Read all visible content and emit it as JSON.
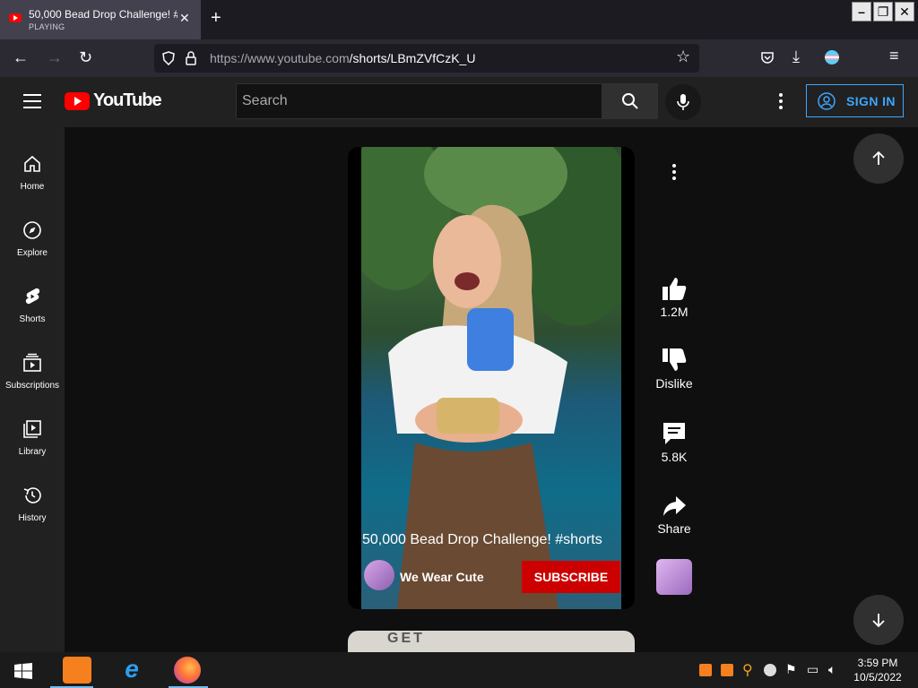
{
  "browser": {
    "tab": {
      "title": "50,000 Bead Drop Challenge! #shorts",
      "status": "PLAYING"
    },
    "url_host": "https://www.youtube.com",
    "url_path": "/shorts/LBmZVfCzK_U"
  },
  "youtube": {
    "logo_text": "YouTube",
    "search_placeholder": "Search",
    "signin_label": "SIGN IN",
    "sidebar": [
      {
        "label": "Home",
        "icon": "home-icon"
      },
      {
        "label": "Explore",
        "icon": "compass-icon"
      },
      {
        "label": "Shorts",
        "icon": "shorts-icon"
      },
      {
        "label": "Subscriptions",
        "icon": "subscriptions-icon"
      },
      {
        "label": "Library",
        "icon": "library-icon"
      },
      {
        "label": "History",
        "icon": "history-icon"
      }
    ],
    "short": {
      "title": "50,000 Bead Drop Challenge! #shorts",
      "channel": "We Wear Cute",
      "subscribe_label": "SUBSCRIBE",
      "likes": "1.2M",
      "dislike_label": "Dislike",
      "comments": "5.8K",
      "share_label": "Share",
      "next_preview_text": "GET"
    }
  },
  "taskbar": {
    "time": "3:59 PM",
    "date": "10/5/2022"
  },
  "colors": {
    "brand_red": "#ff0000",
    "subscribe_red": "#cc0000",
    "link_blue": "#3ea6ff"
  }
}
